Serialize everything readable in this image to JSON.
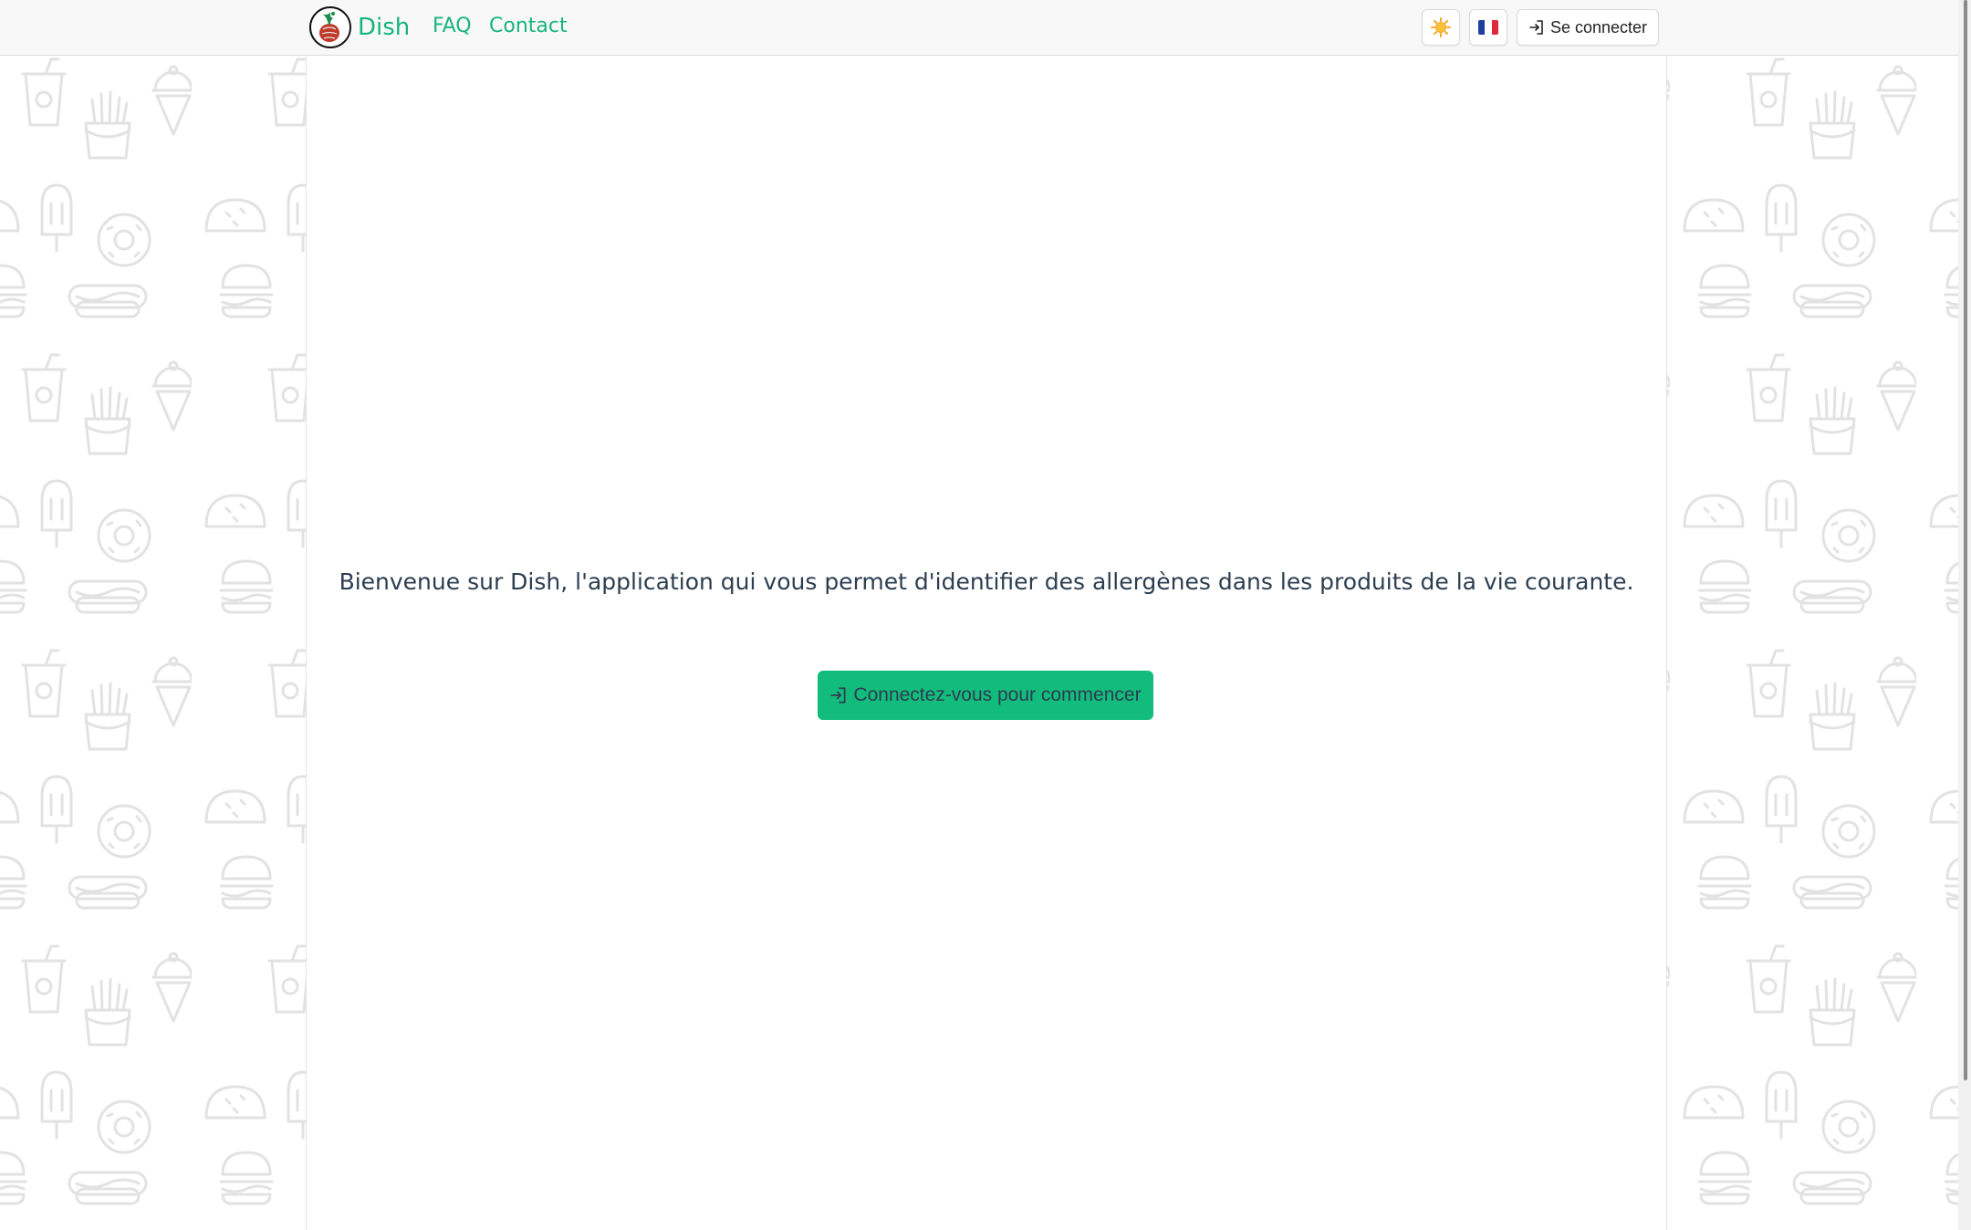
{
  "navbar": {
    "brand": "Dish",
    "links": {
      "faq": "FAQ",
      "contact": "Contact"
    },
    "theme_icon": "sun-icon",
    "language_flag": "france-flag-icon",
    "login_icon": "login-icon",
    "login_label": "Se connecter"
  },
  "main": {
    "welcome": "Bienvenue sur Dish, l'application qui vous permet d'identifier des allergènes dans les produits de la vie courante.",
    "cta_icon": "login-icon",
    "cta_label": "Connectez-vous pour commencer"
  },
  "background": {
    "pattern_icons": [
      "soda-cup-icon",
      "french-fries-icon",
      "ice-cream-cone-icon",
      "ice-pop-icon",
      "donut-icon",
      "taco-icon",
      "burger-icon",
      "hot-dog-icon"
    ]
  },
  "colors": {
    "accent": "#17b57d",
    "cta_background": "#12bc7d",
    "navbar_background": "#f8f8f8",
    "pattern_stroke": "#e2e2e2",
    "sun": "#f5a623",
    "flag_blue": "#1f3fa0",
    "flag_white": "#ffffff",
    "flag_red": "#e0283a"
  }
}
